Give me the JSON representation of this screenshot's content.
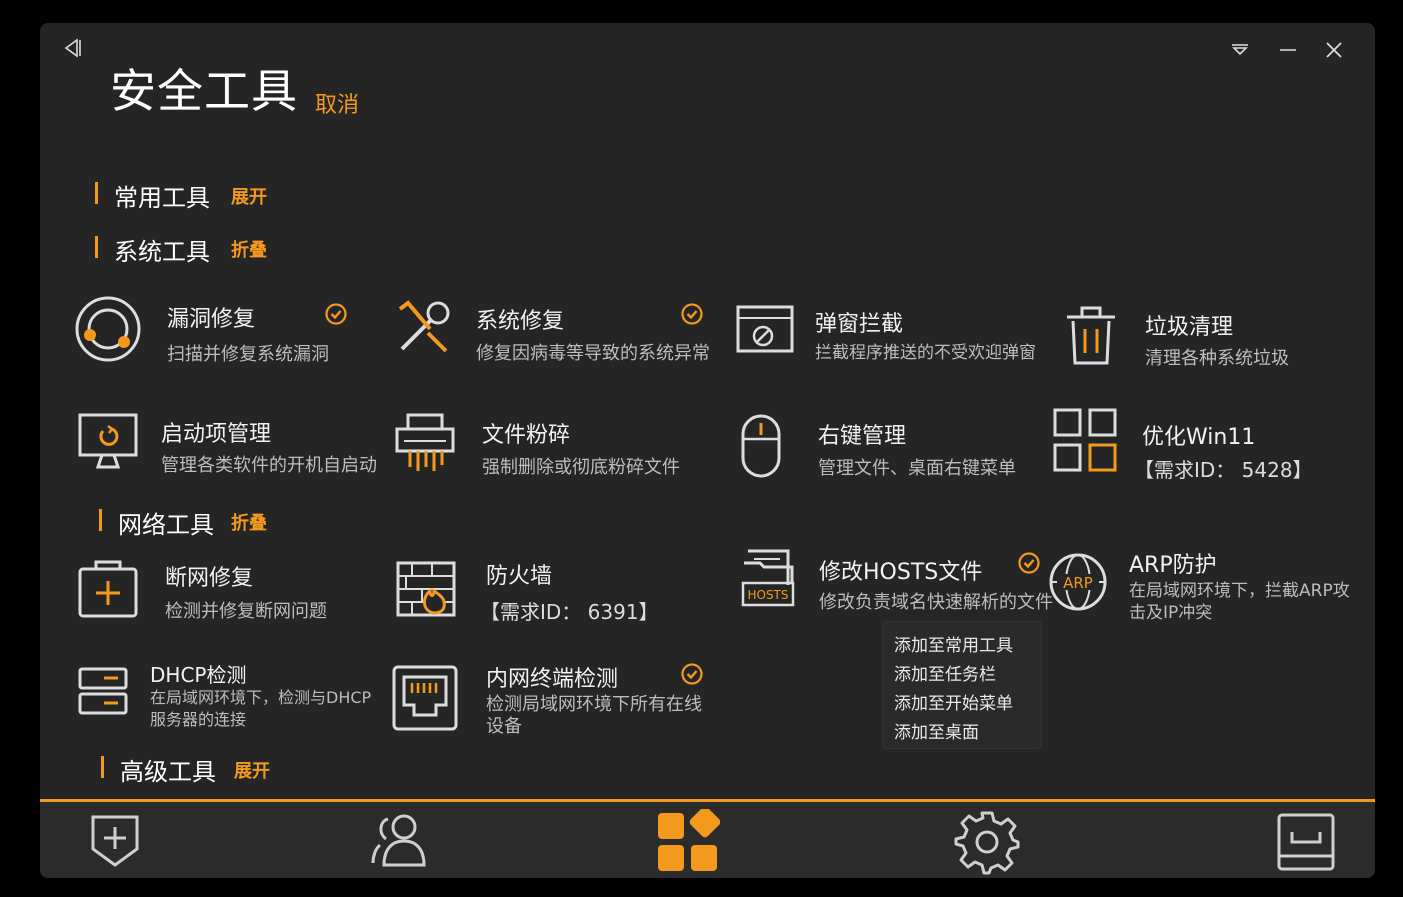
{
  "header": {
    "title": "安全工具",
    "cancel_label": "取消"
  },
  "window_controls": [
    "collapse-icon",
    "dropdown-icon",
    "minimize-icon",
    "close-icon"
  ],
  "sections": {
    "common": {
      "label": "常用工具",
      "toggle": "展开"
    },
    "system": {
      "label": "系统工具",
      "toggle": "折叠"
    },
    "network": {
      "label": "网络工具",
      "toggle": "折叠"
    },
    "advanced": {
      "label": "高级工具",
      "toggle": "展开"
    }
  },
  "system_tools": [
    {
      "name": "漏洞修复",
      "desc": "扫描并修复系统漏洞",
      "checked": true,
      "icon": "vulnerability-repair-icon"
    },
    {
      "name": "系统修复",
      "desc": "修复因病毒等导致的系统异常",
      "checked": true,
      "icon": "system-repair-icon"
    },
    {
      "name": "弹窗拦截",
      "desc": "拦截程序推送的不受欢迎弹窗",
      "checked": false,
      "icon": "popup-block-icon"
    },
    {
      "name": "垃圾清理",
      "desc": "清理各种系统垃圾",
      "checked": false,
      "icon": "trash-icon"
    },
    {
      "name": "启动项管理",
      "desc": "管理各类软件的开机自启动",
      "checked": false,
      "icon": "startup-manager-icon"
    },
    {
      "name": "文件粉碎",
      "desc": "强制删除或彻底粉碎文件",
      "checked": false,
      "icon": "file-shredder-icon"
    },
    {
      "name": "右键管理",
      "desc": "管理文件、桌面右键菜单",
      "checked": false,
      "icon": "mouse-icon"
    },
    {
      "name": "优化Win11",
      "desc": "【需求ID： 5428】",
      "checked": false,
      "icon": "windows-grid-icon"
    }
  ],
  "network_tools": [
    {
      "name": "断网修复",
      "desc": "检测并修复断网问题",
      "checked": false,
      "icon": "network-repair-icon"
    },
    {
      "name": "防火墙",
      "desc": "【需求ID： 6391】",
      "checked": false,
      "icon": "firewall-icon"
    },
    {
      "name": "修改HOSTS文件",
      "desc": "修改负责域名快速解析的文件",
      "checked": true,
      "icon": "hosts-file-icon"
    },
    {
      "name": "ARP防护",
      "desc": "在局域网环境下，拦截ARP攻击及IP冲突",
      "checked": false,
      "icon": "arp-globe-icon"
    },
    {
      "name": "DHCP检测",
      "desc": "在局域网环境下，检测与DHCP服务器的连接",
      "checked": false,
      "icon": "dhcp-server-icon"
    },
    {
      "name": "内网终端检测",
      "desc": "检测局域网环境下所有在线设备",
      "checked": true,
      "icon": "ethernet-port-icon"
    }
  ],
  "context_menu": [
    "添加至常用工具",
    "添加至任务栏",
    "添加至开始菜单",
    "添加至桌面"
  ],
  "bottom_nav": [
    {
      "icon": "shield-plus-icon",
      "active": false
    },
    {
      "icon": "users-icon",
      "active": false
    },
    {
      "icon": "apps-icon",
      "active": true
    },
    {
      "icon": "settings-icon",
      "active": false
    },
    {
      "icon": "inbox-icon",
      "active": false
    }
  ],
  "colors": {
    "accent": "#f39a1e",
    "background": "#252525",
    "bottom_bar": "#2b2b2b"
  }
}
